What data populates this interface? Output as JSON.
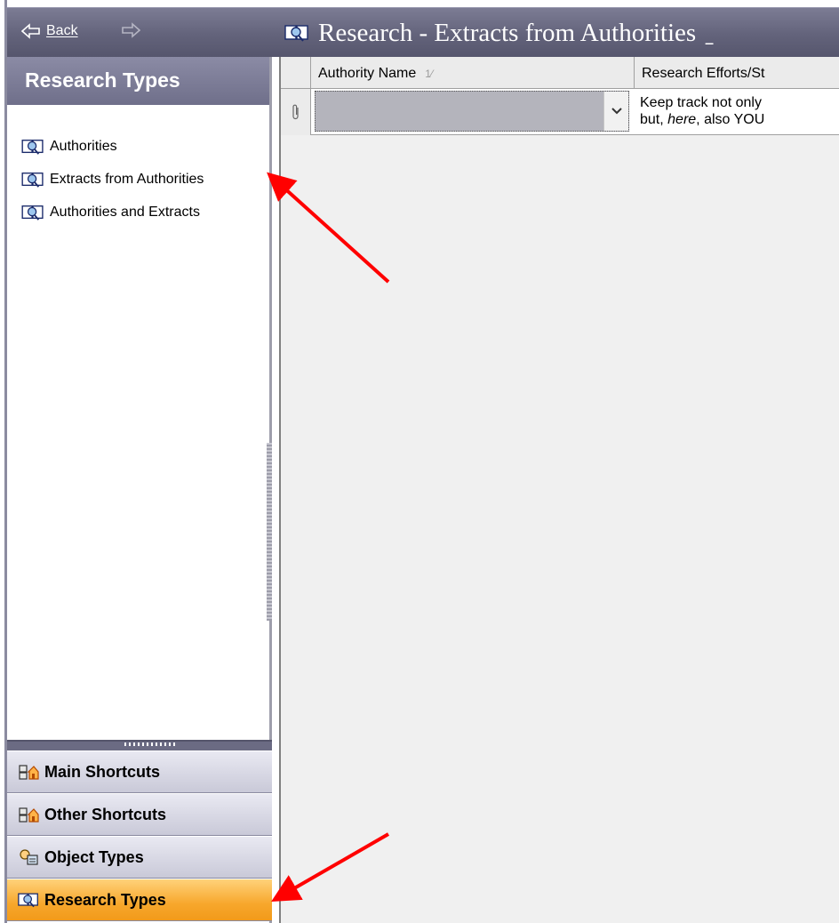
{
  "toolbar": {
    "back_label": "Back",
    "title": "Research - Extracts from Authorities",
    "title_suffix": "ˍ"
  },
  "nav": {
    "header": "Research Types",
    "items": [
      {
        "label": "Authorities",
        "icon": "book-icon"
      },
      {
        "label": "Extracts from Authorities",
        "icon": "book-icon"
      },
      {
        "label": "Authorities and Extracts",
        "icon": "book-icon"
      }
    ],
    "groups": [
      {
        "label": "Main Shortcuts",
        "icon": "shortcuts-icon",
        "active": false
      },
      {
        "label": "Other Shortcuts",
        "icon": "shortcuts-icon",
        "active": false
      },
      {
        "label": "Object Types",
        "icon": "object-types-icon",
        "active": false
      },
      {
        "label": "Research Types",
        "icon": "book-icon",
        "active": true
      }
    ]
  },
  "grid": {
    "columns": [
      {
        "label": "Authority Name",
        "sort": "1⁄"
      },
      {
        "label": "Research Efforts/St"
      }
    ],
    "rows": [
      {
        "authority_name": "",
        "research_line1": "Keep track not only",
        "research_line2_pre": "but, ",
        "research_line2_em": "here",
        "research_line2_post": ", also YOU"
      }
    ]
  },
  "colors": {
    "header_bar": "#6f6f8a",
    "active_group": "#f7a72c",
    "annotation_arrow": "#ff0000"
  }
}
